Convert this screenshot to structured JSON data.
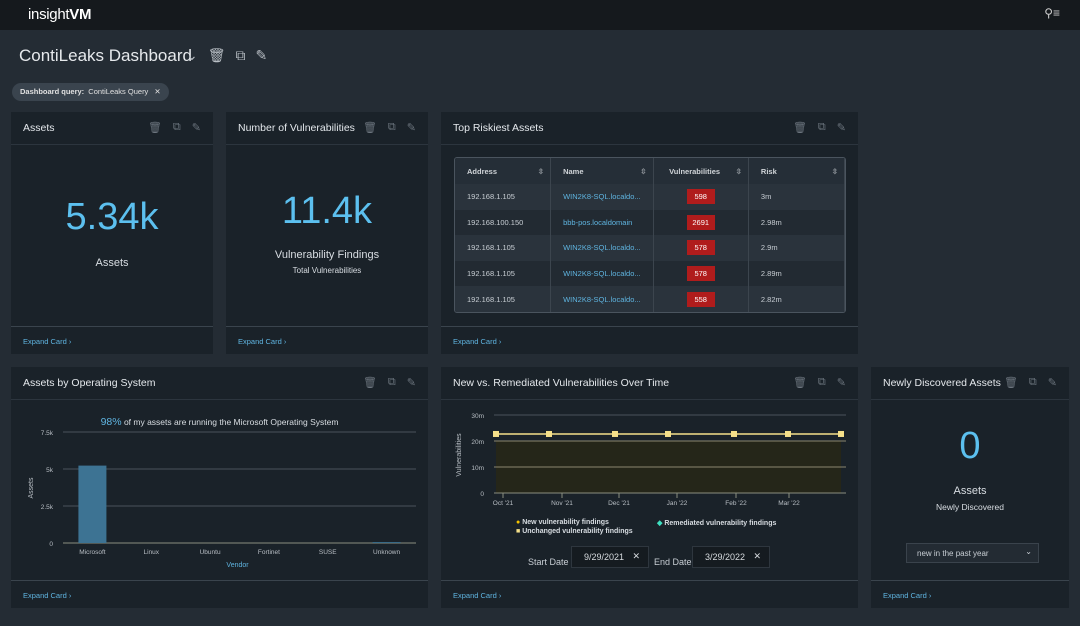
{
  "app": {
    "logo_prefix": "insight",
    "logo_suffix": "VM"
  },
  "dashboard": {
    "title": "ContiLeaks Dashboard",
    "query_chip": "Dashboard query:",
    "query_value": "ContiLeaks Query"
  },
  "cards": {
    "assets": {
      "title": "Assets",
      "value": "5.34k",
      "label": "Assets",
      "expand": "Expand Card ›"
    },
    "vulns": {
      "title": "Number of Vulnerabilities",
      "value": "11.4k",
      "label": "Vulnerability Findings",
      "sublabel": "Total Vulnerabilities",
      "expand": "Expand Card ›"
    },
    "risky": {
      "title": "Top Riskiest Assets",
      "expand": "Expand Card ›",
      "columns": [
        "Address",
        "Name",
        "Vulnerabilities",
        "Risk"
      ],
      "rows": [
        [
          "192.168.1.105",
          "WIN2K8-SQL.localdo...",
          "598",
          "3m"
        ],
        [
          "192.168.100.150",
          "bbb-pos.localdomain",
          "2691",
          "2.98m"
        ],
        [
          "192.168.1.105",
          "WIN2K8-SQL.localdo...",
          "578",
          "2.9m"
        ],
        [
          "192.168.1.105",
          "WIN2K8-SQL.localdo...",
          "578",
          "2.89m"
        ],
        [
          "192.168.1.105",
          "WIN2K8-SQL.localdo...",
          "558",
          "2.82m"
        ]
      ]
    },
    "os": {
      "title": "Assets by Operating System",
      "headline_pct": "98%",
      "headline_text": " of my assets are running the Microsoft Operating System",
      "expand": "Expand Card ›"
    },
    "trend": {
      "title": "New vs. Remediated Vulnerabilities Over Time",
      "legend": [
        "New vulnerability findings",
        "Remediated vulnerability findings",
        "Unchanged vulnerability findings"
      ],
      "start_label": "Start Date",
      "start": "9/29/2021",
      "end_label": "End Date",
      "end": "3/29/2022",
      "expand": "Expand Card ›"
    },
    "newly": {
      "title": "Newly Discovered Assets",
      "value": "0",
      "label": "Assets",
      "sublabel": "Newly Discovered",
      "select": "new in the past year",
      "expand": "Expand Card ›"
    }
  },
  "chart_data": [
    {
      "type": "bar",
      "categories": [
        "Microsoft",
        "Linux",
        "Ubuntu",
        "Fortinet",
        "SUSE",
        "Unknown"
      ],
      "values": [
        5230,
        0,
        0,
        0,
        0,
        60
      ],
      "xlabel": "Vendor",
      "ylabel": "Assets",
      "ylim": [
        0,
        7500
      ],
      "yticks": [
        "0",
        "2.5k",
        "5k",
        "7.5k"
      ],
      "color": "#3d7393"
    },
    {
      "type": "area",
      "x": [
        "Sep 29 '21",
        "Oct 22 '21",
        "Nov 27 '21",
        "Dec 22 '21",
        "Jan 27 '22",
        "Feb 21 '22",
        "Mar 29 '22"
      ],
      "series": [
        {
          "name": "Unchanged vulnerability findings",
          "values": [
            22.7,
            22.7,
            22.7,
            22.7,
            22.7,
            22.7,
            22.7
          ]
        }
      ],
      "ylabel": "Vulnerabilities",
      "ylim": [
        0,
        30
      ],
      "yticks": [
        "0",
        "10m",
        "20m",
        "30m"
      ],
      "xticks": [
        "Oct '21",
        "Nov '21",
        "Dec '21",
        "Jan '22",
        "Feb '22",
        "Mar '22"
      ],
      "color": "#f5e08a"
    }
  ]
}
